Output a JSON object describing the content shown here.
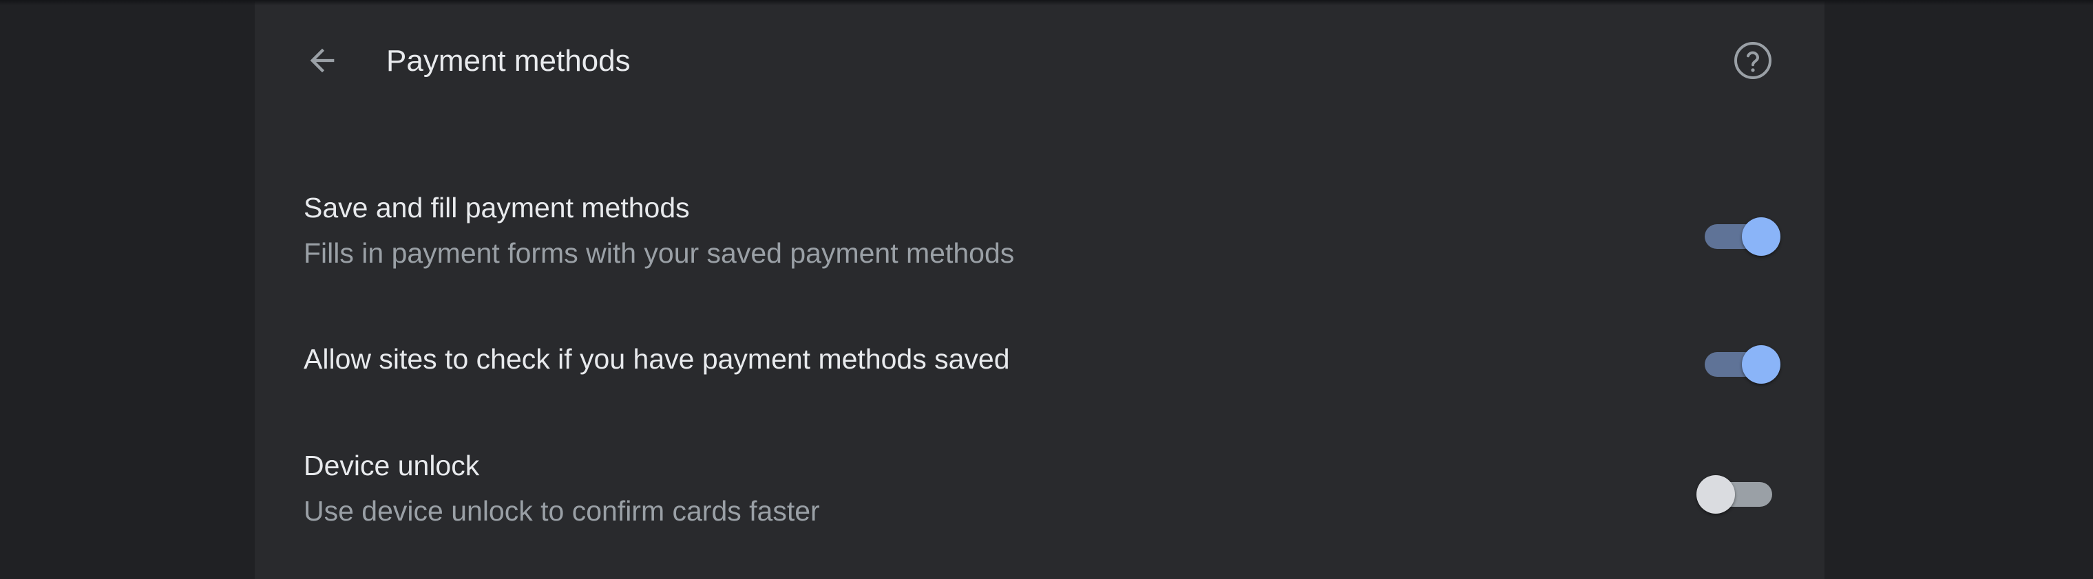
{
  "header": {
    "back_icon": "arrow-back-icon",
    "title": "Payment methods",
    "help_icon": "help-circle-icon"
  },
  "settings": [
    {
      "label": "Save and fill payment methods",
      "description": "Fills in payment forms with your saved payment methods",
      "enabled": true
    },
    {
      "label": "Allow sites to check if you have payment methods saved",
      "enabled": true
    },
    {
      "label": "Device unlock",
      "description": "Use device unlock to confirm cards faster",
      "enabled": false
    }
  ],
  "colors": {
    "page_background": "#202124",
    "card_background": "#292a2d",
    "primary_text": "#e8eaed",
    "secondary_text": "#9aa0a6",
    "toggle_on_knob": "#8ab4f8",
    "toggle_on_track": "#5f7397",
    "toggle_off_knob": "#dadce0",
    "toggle_off_track": "#9aa0a6"
  }
}
